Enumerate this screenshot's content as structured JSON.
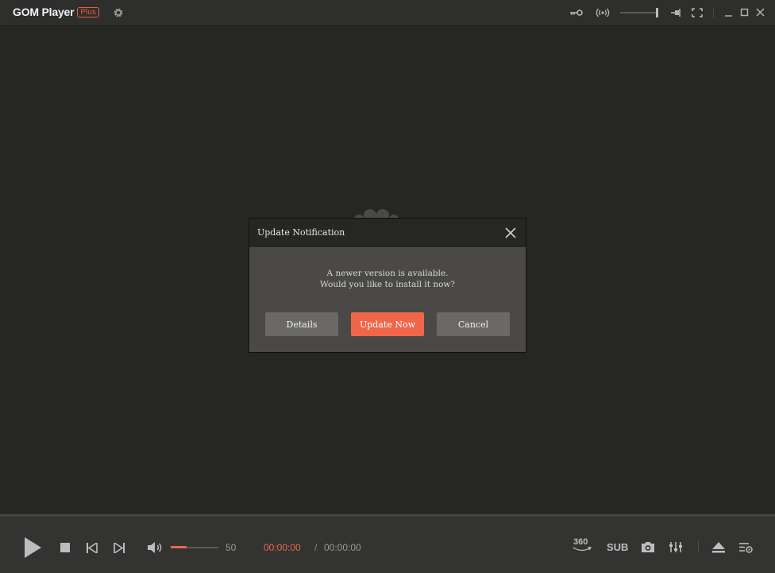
{
  "app": {
    "name": "GOM Player",
    "badge": "Plus"
  },
  "titlebar": {
    "icons": [
      "settings-icon",
      "key-icon",
      "broadcast-icon",
      "volume-slider",
      "pin-icon",
      "fullscreen-icon",
      "minimize-icon",
      "maximize-icon",
      "close-icon"
    ]
  },
  "dialog": {
    "title": "Update Notification",
    "message_line1": "A newer version is available.",
    "message_line2": "Would you like to install it now?",
    "details_label": "Details",
    "update_label": "Update Now",
    "cancel_label": "Cancel"
  },
  "controls": {
    "volume_value": "50",
    "time_current": "00:00:00",
    "time_separator": "/",
    "time_total": "00:00:00",
    "vr_label": "360",
    "sub_label": "SUB"
  },
  "colors": {
    "accent": "#f0664a",
    "background": "#262625",
    "dialog_body": "#4a4947"
  }
}
